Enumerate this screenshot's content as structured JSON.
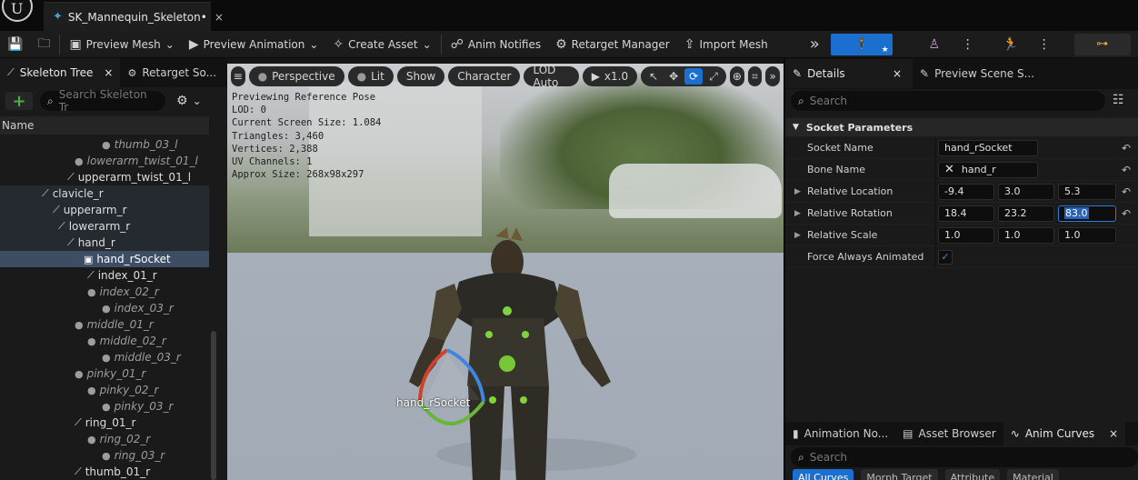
{
  "app": {
    "logo_glyph": "U"
  },
  "document_tab": {
    "title": "SK_Mannequin_Skeleton•",
    "close": "×"
  },
  "toolbar": {
    "preview_mesh": "Preview Mesh",
    "preview_animation": "Preview Animation",
    "create_asset": "Create Asset",
    "anim_notifies": "Anim Notifies",
    "retarget_manager": "Retarget Manager",
    "import_mesh": "Import Mesh",
    "overflow": "»",
    "mode_accent": "#1a6fcf",
    "mode_physics_accent": "#4a3a5a",
    "mode_blueprint_accent": "#3a3320"
  },
  "left_panel": {
    "tabs": [
      {
        "label": "Skeleton Tree",
        "close": "×"
      },
      {
        "label": "Retarget So..."
      }
    ],
    "search_placeholder": "Search Skeleton Tr",
    "column_header": "Name",
    "tree": [
      {
        "label": "thumb_03_l",
        "style": "dim"
      },
      {
        "label": "lowerarm_twist_01_l",
        "style": "dim"
      },
      {
        "label": "upperarm_twist_01_l",
        "style": "normal"
      },
      {
        "label": "clavicle_r",
        "style": "hl"
      },
      {
        "label": "upperarm_r",
        "style": "hl"
      },
      {
        "label": "lowerarm_r",
        "style": "hl"
      },
      {
        "label": "hand_r",
        "style": "hl"
      },
      {
        "label": "hand_rSocket",
        "style": "sel"
      },
      {
        "label": "index_01_r",
        "style": "normal"
      },
      {
        "label": "index_02_r",
        "style": "dim"
      },
      {
        "label": "index_03_r",
        "style": "dim"
      },
      {
        "label": "middle_01_r",
        "style": "dim"
      },
      {
        "label": "middle_02_r",
        "style": "dim"
      },
      {
        "label": "middle_03_r",
        "style": "dim"
      },
      {
        "label": "pinky_01_r",
        "style": "dim"
      },
      {
        "label": "pinky_02_r",
        "style": "dim"
      },
      {
        "label": "pinky_03_r",
        "style": "dim"
      },
      {
        "label": "ring_01_r",
        "style": "normal"
      },
      {
        "label": "ring_02_r",
        "style": "dim"
      },
      {
        "label": "ring_03_r",
        "style": "dim"
      },
      {
        "label": "thumb_01_r",
        "style": "normal"
      }
    ]
  },
  "viewport": {
    "menu_icon": "≡",
    "perspective": "Perspective",
    "lit": "Lit",
    "show": "Show",
    "character": "Character",
    "lod": "LOD Auto",
    "play_speed": "x1.0",
    "stats": [
      "Previewing Reference Pose",
      "LOD: 0",
      "Current Screen Size: 1.084",
      "Triangles: 3,460",
      "Vertices: 2,388",
      "UV Channels: 1",
      "Approx Size: 268x98x297"
    ],
    "socket_label": "hand_rSocket"
  },
  "details": {
    "tabs": [
      {
        "label": "Details",
        "close": "×"
      },
      {
        "label": "Preview Scene S..."
      }
    ],
    "search_placeholder": "Search",
    "section": "Socket Parameters",
    "socket_name_label": "Socket Name",
    "socket_name": "hand_rSocket",
    "bone_name_label": "Bone Name",
    "bone_name": "hand_r",
    "relative_location_label": "Relative Location",
    "relative_location": [
      "-9.4",
      "3.0",
      "5.3"
    ],
    "relative_rotation_label": "Relative Rotation",
    "relative_rotation": [
      "18.4",
      "23.2",
      "83.0"
    ],
    "relative_scale_label": "Relative Scale",
    "relative_scale": [
      "1.0",
      "1.0",
      "1.0"
    ],
    "force_animated_label": "Force Always Animated",
    "reset_glyph": "↶"
  },
  "bottom_tabs": {
    "tabs": [
      "Animation No...",
      "Asset Browser",
      "Anim Curves"
    ],
    "close": "×",
    "search_placeholder": "Search",
    "filters": [
      "All Curves",
      "Morph Target",
      "Attribute",
      "Material"
    ]
  }
}
